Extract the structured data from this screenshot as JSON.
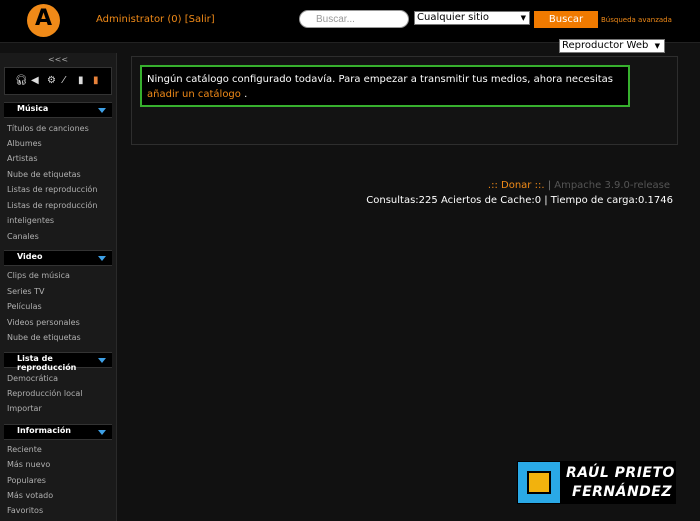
{
  "header": {
    "logo_letter": "A",
    "user_label": "Administrator (0)",
    "logout_label": "[Salir]",
    "search_placeholder": "Buscar...",
    "search_scope": "Cualquier sitio",
    "search_button": "Buscar",
    "advanced_search": "Búsqueda avanzada",
    "player_mode": "Reproductor Web"
  },
  "sidebar": {
    "collapse_label": "<<<",
    "toolbar_icons": [
      "headphones-icon",
      "speaker-icon",
      "gear-icon",
      "tool-icon",
      "trash-icon",
      "book-icon"
    ],
    "sections": [
      {
        "title": "Música",
        "items": [
          "Títulos de canciones",
          "Albumes",
          "Artistas",
          "Nube de etiquetas",
          "Listas de reproducción",
          "Listas de reproducción",
          "inteligentes",
          "Canales"
        ]
      },
      {
        "title": "Video",
        "items": [
          "Clips de música",
          "Series TV",
          "Películas",
          "Videos personales",
          "Nube de etiquetas"
        ]
      },
      {
        "title": "Lista de reproducción",
        "items": [
          "Democrática",
          "Reproducción local",
          "Importar"
        ]
      },
      {
        "title": "Información",
        "items": [
          "Reciente",
          "Más nuevo",
          "Populares",
          "Más votado",
          "Favoritos"
        ]
      }
    ]
  },
  "notice": {
    "text": "Ningún catálogo configurado todavía. Para empezar a transmitir tus medios, ahora necesitas",
    "link": "añadir un catálogo",
    "suffix": " ."
  },
  "footer": {
    "donate": ".:: Donar ::.",
    "separator": "|",
    "version": "Ampache 3.9.0-release",
    "stats": "Consultas:225 Aciertos de Cache:0 | Tiempo de carga:0.1746"
  },
  "watermark": {
    "line1": "RAÚL PRIETO",
    "line2": "FERNÁNDEZ"
  }
}
